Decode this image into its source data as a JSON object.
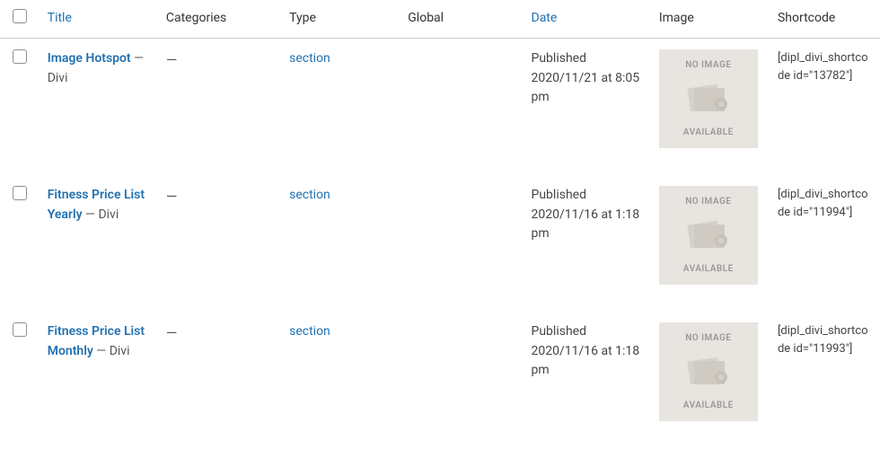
{
  "columns": {
    "title": "Title",
    "categories": "Categories",
    "type": "Type",
    "global": "Global",
    "date": "Date",
    "image": "Image",
    "shortcode": "Shortcode"
  },
  "placeholder": {
    "top": "NO IMAGE",
    "bottom": "AVAILABLE"
  },
  "rows": [
    {
      "title": "Image Hotspot",
      "state_sep": " — ",
      "state": "Divi",
      "categories": "—",
      "type": "section",
      "global": "",
      "date_status": "Published",
      "date_line": "2020/11/21 at 8:05 pm",
      "shortcode": "[dipl_divi_shortcode id=\"13782\"]"
    },
    {
      "title": "Fitness Price List Yearly",
      "state_sep": " — ",
      "state": "Divi",
      "categories": "—",
      "type": "section",
      "global": "",
      "date_status": "Published",
      "date_line": "2020/11/16 at 1:18 pm",
      "shortcode": "[dipl_divi_shortcode id=\"11994\"]"
    },
    {
      "title": "Fitness Price List Monthly",
      "state_sep": " — ",
      "state": "Divi",
      "categories": "—",
      "type": "section",
      "global": "",
      "date_status": "Published",
      "date_line": "2020/11/16 at 1:18 pm",
      "shortcode": "[dipl_divi_shortcode id=\"11993\"]"
    }
  ]
}
